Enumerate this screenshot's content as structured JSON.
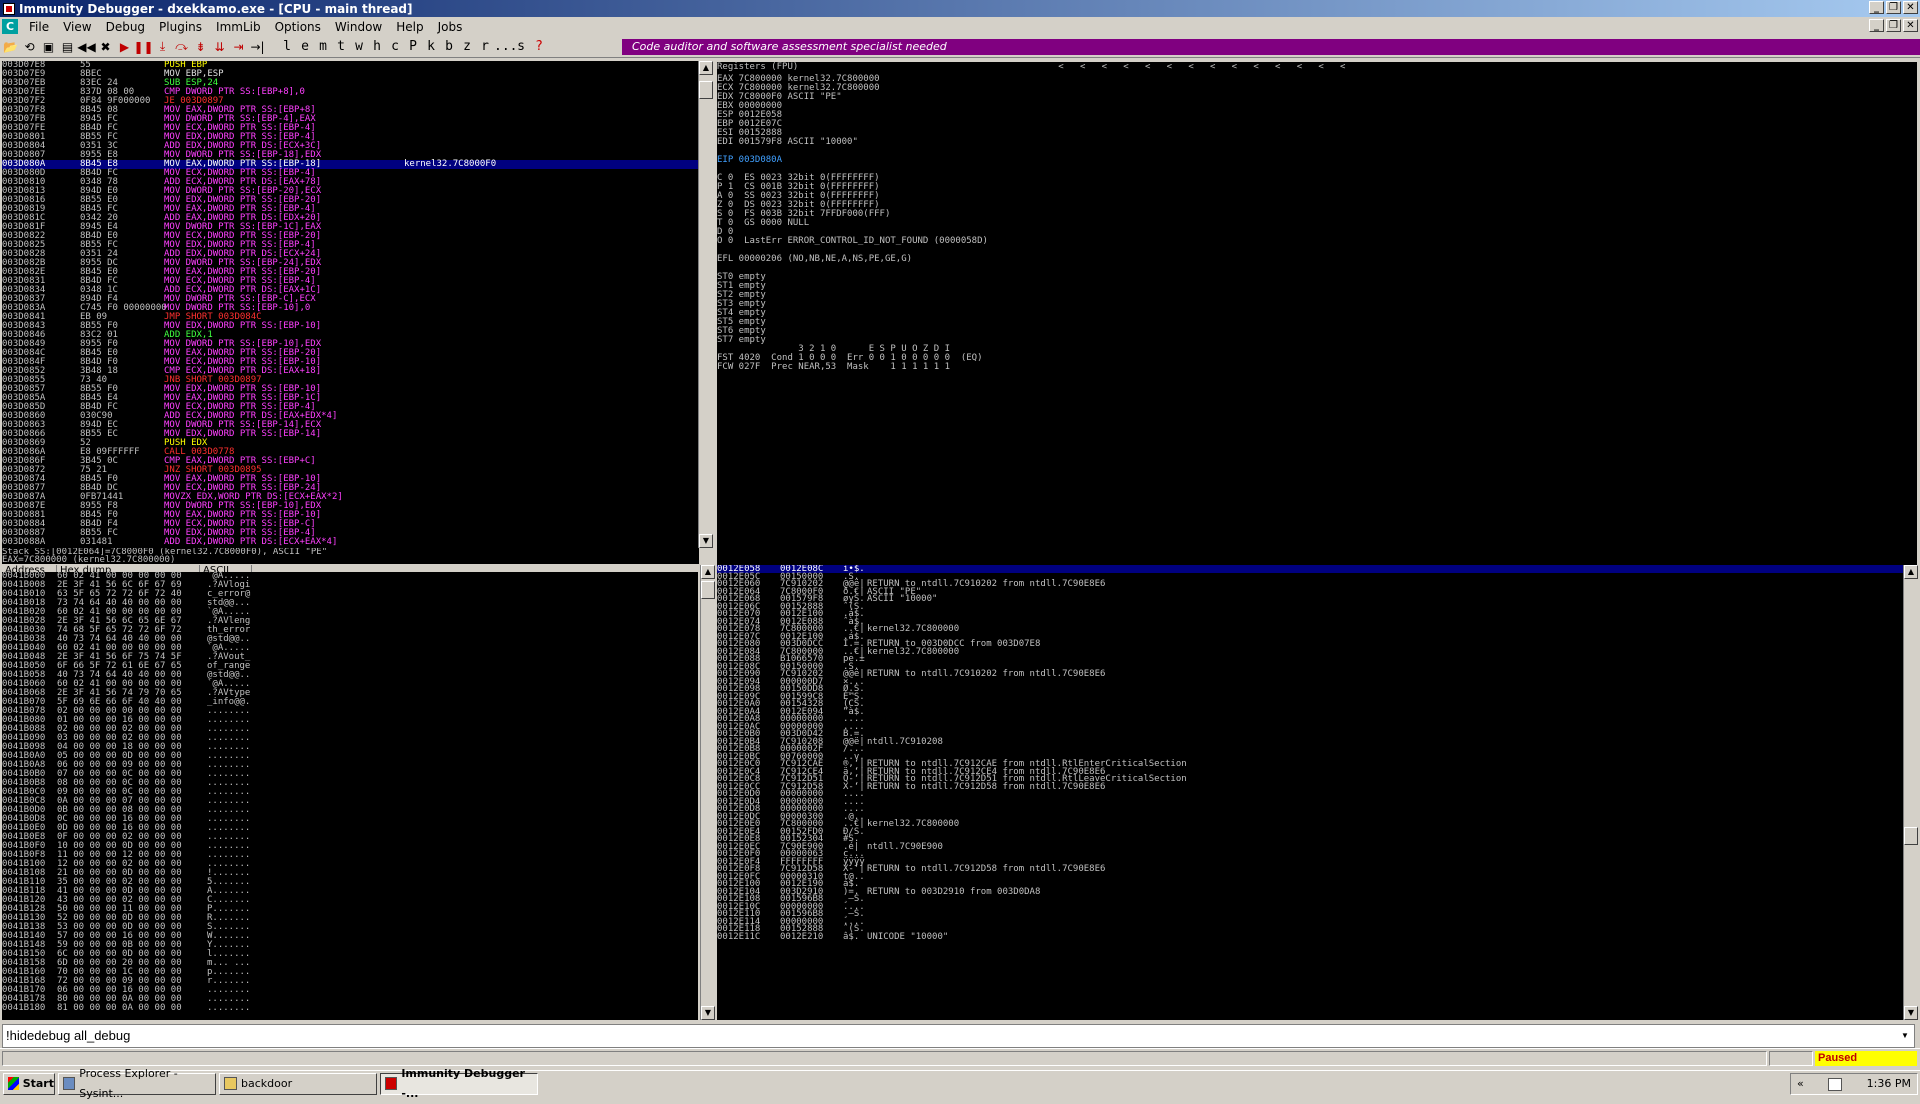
{
  "window": {
    "title": "Immunity Debugger - dxekkamo.exe - [CPU - main thread]"
  },
  "menu": [
    "File",
    "View",
    "Debug",
    "Plugins",
    "ImmLib",
    "Options",
    "Window",
    "Help",
    "Jobs"
  ],
  "toolbar": {
    "letters": [
      "l",
      "e",
      "m",
      "t",
      "w",
      "h",
      "c",
      "P",
      "k",
      "b",
      "z",
      "r",
      "...",
      "s",
      "?"
    ],
    "banner": "Code auditor and software assessment specialist needed"
  },
  "cpu": {
    "rows": [
      [
        "003D07E8",
        "55",
        "PUSH EBP",
        "",
        ""
      ],
      [
        "003D07E9",
        "8BEC",
        "MOV EBP,ESP",
        "",
        ""
      ],
      [
        "003D07EB",
        "83EC 24",
        "SUB ESP,24",
        "",
        ""
      ],
      [
        "003D07EE",
        "837D 08 00",
        "CMP DWORD PTR SS:[EBP+8],0",
        "",
        ""
      ],
      [
        "003D07F2",
        "0F84 9F000000",
        "JE 003D0897",
        "",
        ""
      ],
      [
        "003D07F8",
        "8B45 08",
        "MOV EAX,DWORD PTR SS:[EBP+8]",
        "",
        ""
      ],
      [
        "003D07FB",
        "8945 FC",
        "MOV DWORD PTR SS:[EBP-4],EAX",
        "",
        ""
      ],
      [
        "003D07FE",
        "8B4D FC",
        "MOV ECX,DWORD PTR SS:[EBP-4]",
        "",
        ""
      ],
      [
        "003D0801",
        "8B55 FC",
        "MOV EDX,DWORD PTR SS:[EBP-4]",
        "",
        ""
      ],
      [
        "003D0804",
        "0351 3C",
        "ADD EDX,DWORD PTR DS:[ECX+3C]",
        "",
        ""
      ],
      [
        "003D0807",
        "8955 E8",
        "MOV DWORD PTR SS:[EBP-18],EDX",
        "",
        ""
      ],
      [
        "003D080A",
        "8B45 E8",
        "MOV EAX,DWORD PTR SS:[EBP-18]",
        "kernel32.7C8000F0",
        "hl"
      ],
      [
        "003D080D",
        "8B4D FC",
        "MOV ECX,DWORD PTR SS:[EBP-4]",
        "",
        ""
      ],
      [
        "003D0810",
        "0348 78",
        "ADD ECX,DWORD PTR DS:[EAX+78]",
        "",
        ""
      ],
      [
        "003D0813",
        "894D E0",
        "MOV DWORD PTR SS:[EBP-20],ECX",
        "",
        ""
      ],
      [
        "003D0816",
        "8B55 E0",
        "MOV EDX,DWORD PTR SS:[EBP-20]",
        "",
        ""
      ],
      [
        "003D0819",
        "8B45 FC",
        "MOV EAX,DWORD PTR SS:[EBP-4]",
        "",
        ""
      ],
      [
        "003D081C",
        "0342 20",
        "ADD EAX,DWORD PTR DS:[EDX+20]",
        "",
        ""
      ],
      [
        "003D081F",
        "8945 E4",
        "MOV DWORD PTR SS:[EBP-1C],EAX",
        "",
        ""
      ],
      [
        "003D0822",
        "8B4D E0",
        "MOV ECX,DWORD PTR SS:[EBP-20]",
        "",
        ""
      ],
      [
        "003D0825",
        "8B55 FC",
        "MOV EDX,DWORD PTR SS:[EBP-4]",
        "",
        ""
      ],
      [
        "003D0828",
        "0351 24",
        "ADD EDX,DWORD PTR DS:[ECX+24]",
        "",
        ""
      ],
      [
        "003D082B",
        "8955 DC",
        "MOV DWORD PTR SS:[EBP-24],EDX",
        "",
        ""
      ],
      [
        "003D082E",
        "8B45 E0",
        "MOV EAX,DWORD PTR SS:[EBP-20]",
        "",
        ""
      ],
      [
        "003D0831",
        "8B4D FC",
        "MOV ECX,DWORD PTR SS:[EBP-4]",
        "",
        ""
      ],
      [
        "003D0834",
        "0348 1C",
        "ADD ECX,DWORD PTR DS:[EAX+1C]",
        "",
        ""
      ],
      [
        "003D0837",
        "894D F4",
        "MOV DWORD PTR SS:[EBP-C],ECX",
        "",
        ""
      ],
      [
        "003D083A",
        "C745 F0 00000000",
        "MOV DWORD PTR SS:[EBP-10],0",
        "",
        ""
      ],
      [
        "003D0841",
        "EB 09",
        "JMP SHORT 003D084C",
        "",
        ""
      ],
      [
        "003D0843",
        "8B55 F0",
        "MOV EDX,DWORD PTR SS:[EBP-10]",
        "",
        ""
      ],
      [
        "003D0846",
        "83C2 01",
        "ADD EDX,1",
        "",
        ""
      ],
      [
        "003D0849",
        "8955 F0",
        "MOV DWORD PTR SS:[EBP-10],EDX",
        "",
        ""
      ],
      [
        "003D084C",
        "8B45 E0",
        "MOV EAX,DWORD PTR SS:[EBP-20]",
        "",
        ""
      ],
      [
        "003D084F",
        "8B4D F0",
        "MOV ECX,DWORD PTR SS:[EBP-10]",
        "",
        ""
      ],
      [
        "003D0852",
        "3B48 18",
        "CMP ECX,DWORD PTR DS:[EAX+18]",
        "",
        ""
      ],
      [
        "003D0855",
        "73 40",
        "JNB SHORT 003D0897",
        "",
        ""
      ],
      [
        "003D0857",
        "8B55 F0",
        "MOV EDX,DWORD PTR SS:[EBP-10]",
        "",
        ""
      ],
      [
        "003D085A",
        "8B45 E4",
        "MOV EAX,DWORD PTR SS:[EBP-1C]",
        "",
        ""
      ],
      [
        "003D085D",
        "8B4D FC",
        "MOV ECX,DWORD PTR SS:[EBP-4]",
        "",
        ""
      ],
      [
        "003D0860",
        "030C90",
        "ADD ECX,DWORD PTR DS:[EAX+EDX*4]",
        "",
        ""
      ],
      [
        "003D0863",
        "894D EC",
        "MOV DWORD PTR SS:[EBP-14],ECX",
        "",
        ""
      ],
      [
        "003D0866",
        "8B55 EC",
        "MOV EDX,DWORD PTR SS:[EBP-14]",
        "",
        ""
      ],
      [
        "003D0869",
        "52",
        "PUSH EDX",
        "",
        ""
      ],
      [
        "003D086A",
        "E8 09FFFFFF",
        "CALL 003D0778",
        "",
        ""
      ],
      [
        "003D086F",
        "3B45 0C",
        "CMP EAX,DWORD PTR SS:[EBP+C]",
        "",
        ""
      ],
      [
        "003D0872",
        "75 21",
        "JNZ SHORT 003D0895",
        "",
        ""
      ],
      [
        "003D0874",
        "8B45 F0",
        "MOV EAX,DWORD PTR SS:[EBP-10]",
        "",
        ""
      ],
      [
        "003D0877",
        "8B4D DC",
        "MOV ECX,DWORD PTR SS:[EBP-24]",
        "",
        ""
      ],
      [
        "003D087A",
        "0FB71441",
        "MOVZX EDX,WORD PTR DS:[ECX+EAX*2]",
        "",
        ""
      ],
      [
        "003D087E",
        "8955 F8",
        "MOV DWORD PTR SS:[EBP-10],EDX",
        "",
        ""
      ],
      [
        "003D0881",
        "8B45 F0",
        "MOV EAX,DWORD PTR SS:[EBP-10]",
        "",
        ""
      ],
      [
        "003D0884",
        "8B4D F4",
        "MOV ECX,DWORD PTR SS:[EBP-C]",
        "",
        ""
      ],
      [
        "003D0887",
        "8B55 FC",
        "MOV EDX,DWORD PTR SS:[EBP-4]",
        "",
        ""
      ],
      [
        "003D088A",
        "031481",
        "ADD EDX,DWORD PTR DS:[ECX+EAX*4]",
        "",
        ""
      ]
    ],
    "info_line1": "Stack SS:[0012E064]=7C8000F0 (kernel32.7C8000F0), ASCII \"PE\"",
    "info_line2": "EAX=7C800000 (kernel32.7C800000)"
  },
  "registers": {
    "header": "Registers (FPU)",
    "arrows": "<   <   <   <   <   <   <   <   <   <   <   <   <   <",
    "lines": [
      "EAX 7C800000 kernel32.7C800000",
      "ECX 7C800000 kernel32.7C800000",
      "EDX 7C8000F0 ASCII \"PE\"",
      "EBX 00000000",
      "ESP 0012E058",
      "EBP 0012E07C",
      "ESI 00152888",
      "EDI 001579F8 ASCII \"10000\"",
      "",
      "EIP 003D080A",
      "",
      "C 0  ES 0023 32bit 0(FFFFFFFF)",
      "P 1  CS 001B 32bit 0(FFFFFFFF)",
      "A 0  SS 0023 32bit 0(FFFFFFFF)",
      "Z 0  DS 0023 32bit 0(FFFFFFFF)",
      "S 0  FS 003B 32bit 7FFDF000(FFF)",
      "T 0  GS 0000 NULL",
      "D 0",
      "O 0  LastErr ERROR_CONTROL_ID_NOT_FOUND (0000058D)",
      "",
      "EFL 00000206 (NO,NB,NE,A,NS,PE,GE,G)",
      "",
      "ST0 empty",
      "ST1 empty",
      "ST2 empty",
      "ST3 empty",
      "ST4 empty",
      "ST5 empty",
      "ST6 empty",
      "ST7 empty",
      "               3 2 1 0      E S P U O Z D I",
      "FST 4020  Cond 1 0 0 0  Err 0 0 1 0 0 0 0 0  (EQ)",
      "FCW 027F  Prec NEAR,53  Mask    1 1 1 1 1 1"
    ]
  },
  "dump": {
    "headers": [
      "Address",
      "Hex dump",
      "ASCII"
    ],
    "rows": [
      [
        "0041B000",
        "60 02 41 00 00 00 00 00",
        "`@A....."
      ],
      [
        "0041B008",
        "2E 3F 41 56 6C 6F 67 69",
        ".?AVlogi"
      ],
      [
        "0041B010",
        "63 5F 65 72 72 6F 72 40",
        "c_error@"
      ],
      [
        "0041B018",
        "73 74 64 40 40 00 00 00",
        "std@@..."
      ],
      [
        "0041B020",
        "60 02 41 00 00 00 00 00",
        "`@A....."
      ],
      [
        "0041B028",
        "2E 3F 41 56 6C 65 6E 67",
        ".?AVleng"
      ],
      [
        "0041B030",
        "74 68 5F 65 72 72 6F 72",
        "th_error"
      ],
      [
        "0041B038",
        "40 73 74 64 40 40 00 00",
        "@std@@.."
      ],
      [
        "0041B040",
        "60 02 41 00 00 00 00 00",
        "`@A....."
      ],
      [
        "0041B048",
        "2E 3F 41 56 6F 75 74 5F",
        ".?AVout_"
      ],
      [
        "0041B050",
        "6F 66 5F 72 61 6E 67 65",
        "of_range"
      ],
      [
        "0041B058",
        "40 73 74 64 40 40 00 00",
        "@std@@.."
      ],
      [
        "0041B060",
        "60 02 41 00 00 00 00 00",
        "`@A....."
      ],
      [
        "0041B068",
        "2E 3F 41 56 74 79 70 65",
        ".?AVtype"
      ],
      [
        "0041B070",
        "5F 69 6E 66 6F 40 40 00",
        "_info@@."
      ],
      [
        "0041B078",
        "02 00 00 00 00 00 00 00",
        "........"
      ],
      [
        "0041B080",
        "01 00 00 00 16 00 00 00",
        "........"
      ],
      [
        "0041B088",
        "02 00 00 00 02 00 00 00",
        "........"
      ],
      [
        "0041B090",
        "03 00 00 00 02 00 00 00",
        "........"
      ],
      [
        "0041B098",
        "04 00 00 00 18 00 00 00",
        "........"
      ],
      [
        "0041B0A0",
        "05 00 00 00 0D 00 00 00",
        "........"
      ],
      [
        "0041B0A8",
        "06 00 00 00 09 00 00 00",
        "........"
      ],
      [
        "0041B0B0",
        "07 00 00 00 0C 00 00 00",
        "........"
      ],
      [
        "0041B0B8",
        "08 00 00 00 0C 00 00 00",
        "........"
      ],
      [
        "0041B0C0",
        "09 00 00 00 0C 00 00 00",
        "........"
      ],
      [
        "0041B0C8",
        "0A 00 00 00 07 00 00 00",
        "........"
      ],
      [
        "0041B0D0",
        "0B 00 00 00 08 00 00 00",
        "........"
      ],
      [
        "0041B0D8",
        "0C 00 00 00 16 00 00 00",
        "........"
      ],
      [
        "0041B0E0",
        "0D 00 00 00 16 00 00 00",
        "........"
      ],
      [
        "0041B0E8",
        "0F 00 00 00 02 00 00 00",
        "........"
      ],
      [
        "0041B0F0",
        "10 00 00 00 0D 00 00 00",
        "........"
      ],
      [
        "0041B0F8",
        "11 00 00 00 12 00 00 00",
        "........"
      ],
      [
        "0041B100",
        "12 00 00 00 02 00 00 00",
        "........"
      ],
      [
        "0041B108",
        "21 00 00 00 0D 00 00 00",
        "!......."
      ],
      [
        "0041B110",
        "35 00 00 00 02 00 00 00",
        "5......."
      ],
      [
        "0041B118",
        "41 00 00 00 0D 00 00 00",
        "A......."
      ],
      [
        "0041B120",
        "43 00 00 00 02 00 00 00",
        "C......."
      ],
      [
        "0041B128",
        "50 00 00 00 11 00 00 00",
        "P......."
      ],
      [
        "0041B130",
        "52 00 00 00 0D 00 00 00",
        "R......."
      ],
      [
        "0041B138",
        "53 00 00 00 0D 00 00 00",
        "S......."
      ],
      [
        "0041B140",
        "57 00 00 00 16 00 00 00",
        "W......."
      ],
      [
        "0041B148",
        "59 00 00 00 0B 00 00 00",
        "Y......."
      ],
      [
        "0041B150",
        "6C 00 00 00 0D 00 00 00",
        "l......."
      ],
      [
        "0041B158",
        "6D 00 00 00 20 00 00 00",
        "m... ..."
      ],
      [
        "0041B160",
        "70 00 00 00 1C 00 00 00",
        "p......."
      ],
      [
        "0041B168",
        "72 00 00 00 09 00 00 00",
        "r......."
      ],
      [
        "0041B170",
        "06 00 00 00 16 00 00 00",
        "........"
      ],
      [
        "0041B178",
        "80 00 00 00 0A 00 00 00",
        "........"
      ],
      [
        "0041B180",
        "81 00 00 00 0A 00 00 00",
        "........"
      ]
    ]
  },
  "stack": {
    "rows": [
      [
        "0012E058",
        "0012E08C",
        "ì•$.",
        "",
        "hl"
      ],
      [
        "0012E05C",
        "00150000",
        ".S.",
        "",
        ""
      ],
      [
        "0012E060",
        "7C910202",
        "@@ë|",
        "RETURN to ntdll.7C910202 from ntdll.7C90E8E6",
        ""
      ],
      [
        "0012E064",
        "7C8000F0",
        "ð.€|",
        "ASCII \"PE\"",
        ""
      ],
      [
        "0012E068",
        "001579F8",
        "øyS.",
        "ASCII \"10000\"",
        ""
      ],
      [
        "0012E06C",
        "00152888",
        "ˆ(S.",
        "",
        ""
      ],
      [
        "0012E070",
        "0012E100",
        ".á$.",
        "",
        ""
      ],
      [
        "0012E074",
        "0012E088",
        "ˆà$.",
        "",
        ""
      ],
      [
        "0012E078",
        "7C800000",
        "..€|",
        "kernel32.7C800000",
        ""
      ],
      [
        "0012E07C",
        "0012E100",
        ".á$.",
        "",
        ""
      ],
      [
        "0012E080",
        "003D0DCC",
        "Ì.=.",
        "RETURN to 003D0DCC from 003D07E8",
        ""
      ],
      [
        "0012E084",
        "7C800000",
        "..€|",
        "kernel32.7C800000",
        ""
      ],
      [
        "0012E088",
        "B1066570",
        "pe.±",
        "",
        ""
      ],
      [
        "0012E08C",
        "00150000",
        ".S.",
        "",
        ""
      ],
      [
        "0012E090",
        "7C910202",
        "@@ë|",
        "RETURN to ntdll.7C910202 from ntdll.7C90E8E6",
        ""
      ],
      [
        "0012E094",
        "000000D7",
        "×...",
        "",
        ""
      ],
      [
        "0012E098",
        "00150DD8",
        "Ø.S.",
        "",
        ""
      ],
      [
        "0012E09C",
        "001599C8",
        "È™S.",
        "",
        ""
      ],
      [
        "0012E0A0",
        "00154328",
        "(CS.",
        "",
        ""
      ],
      [
        "0012E0A4",
        "0012E094",
        "”à$.",
        "",
        ""
      ],
      [
        "0012E0A8",
        "00000000",
        "....",
        "",
        ""
      ],
      [
        "0012E0AC",
        "00000000",
        "....",
        "",
        ""
      ],
      [
        "0012E0B0",
        "003D0D42",
        "B.=.",
        "",
        ""
      ],
      [
        "0012E0B4",
        "7C910208",
        "@@ë|",
        "ntdll.7C910208",
        ""
      ],
      [
        "0012E0B8",
        "0000002F",
        "/...",
        "",
        ""
      ],
      [
        "0012E0BC",
        "00760000",
        "..v.",
        "",
        ""
      ],
      [
        "0012E0C0",
        "7C912CAE",
        "®,‘|",
        "RETURN to ntdll.7C912CAE from ntdll.RtlEnterCriticalSection",
        ""
      ],
      [
        "0012E0C4",
        "7C912CE4",
        "ä,‘|",
        "RETURN to ntdll.7C912CE4 from ntdll.7C90E8E6",
        ""
      ],
      [
        "0012E0C8",
        "7C912D51",
        "Q-‘|",
        "RETURN to ntdll.7C912D51 from ntdll.RtlLeaveCriticalSection",
        ""
      ],
      [
        "0012E0CC",
        "7C912D58",
        "X-‘|",
        "RETURN to ntdll.7C912D58 from ntdll.7C90E8E6",
        ""
      ],
      [
        "0012E0D0",
        "00000000",
        "....",
        "",
        ""
      ],
      [
        "0012E0D4",
        "00000000",
        "....",
        "",
        ""
      ],
      [
        "0012E0D8",
        "00000000",
        "....",
        "",
        ""
      ],
      [
        "0012E0DC",
        "00000300",
        ".@..",
        "",
        ""
      ],
      [
        "0012E0E0",
        "7C800000",
        "..€|",
        "kernel32.7C800000",
        ""
      ],
      [
        "0012E0E4",
        "00152FD0",
        "Ð/S.",
        "",
        ""
      ],
      [
        "0012E0E8",
        "00152304",
        "#S.",
        "",
        ""
      ],
      [
        "0012E0EC",
        "7C90E900",
        ".é|",
        "ntdll.7C90E900",
        ""
      ],
      [
        "0012E0F0",
        "00000063",
        "c...",
        "",
        ""
      ],
      [
        "0012E0F4",
        "FFFFFFFF",
        "ÿÿÿÿ",
        "",
        ""
      ],
      [
        "0012E0F8",
        "7C912D58",
        "X-‘|",
        "RETURN to ntdll.7C912D58 from ntdll.7C90E8E6",
        ""
      ],
      [
        "0012E0FC",
        "00000310",
        "t@..",
        "",
        ""
      ],
      [
        "0012E100",
        "0012E190",
        "á$.",
        "",
        ""
      ],
      [
        "0012E104",
        "003D2910",
        ")=.",
        "RETURN to 003D2910 from 003D0DA8",
        ""
      ],
      [
        "0012E108",
        "001596B8",
        "¸–S.",
        "",
        ""
      ],
      [
        "0012E10C",
        "00000000",
        "....",
        "",
        ""
      ],
      [
        "0012E110",
        "001596B8",
        "¸–S.",
        "",
        ""
      ],
      [
        "0012E114",
        "00000000",
        "....",
        "",
        ""
      ],
      [
        "0012E118",
        "00152888",
        "ˆ(S.",
        "",
        ""
      ],
      [
        "0012E11C",
        "0012E210",
        "â$.",
        "UNICODE \"10000\"",
        ""
      ]
    ]
  },
  "command": {
    "value": "!hidedebug all_debug"
  },
  "status": {
    "state": "Paused"
  },
  "taskbar": {
    "start": "Start",
    "items": [
      "Process Explorer - Sysint...",
      "backdoor",
      "Immunity Debugger -..."
    ],
    "clock": "1:36 PM"
  }
}
